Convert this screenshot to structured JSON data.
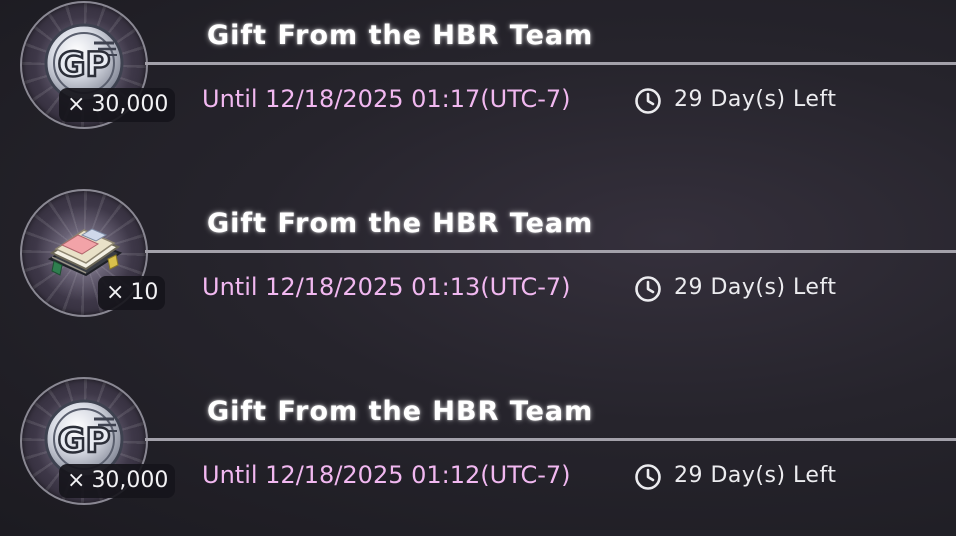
{
  "gifts": [
    {
      "item_icon": "gp-coin-icon",
      "quantity": "30,000",
      "title": "Gift From the HBR Team",
      "until": "Until 12/18/2025 01:17(UTC-7)",
      "time_left": "29 Day(s) Left"
    },
    {
      "item_icon": "ticket-book-icon",
      "quantity": "10",
      "title": "Gift From the HBR Team",
      "until": "Until 12/18/2025 01:13(UTC-7)",
      "time_left": "29 Day(s) Left"
    },
    {
      "item_icon": "gp-coin-icon",
      "quantity": "30,000",
      "title": "Gift From the HBR Team",
      "until": "Until 12/18/2025 01:12(UTC-7)",
      "time_left": "29 Day(s) Left"
    }
  ],
  "qty_prefix": "×",
  "colors": {
    "until_text": "#f1b8f0",
    "title_text": "#ffffff",
    "divider": "#a3a1aa"
  }
}
